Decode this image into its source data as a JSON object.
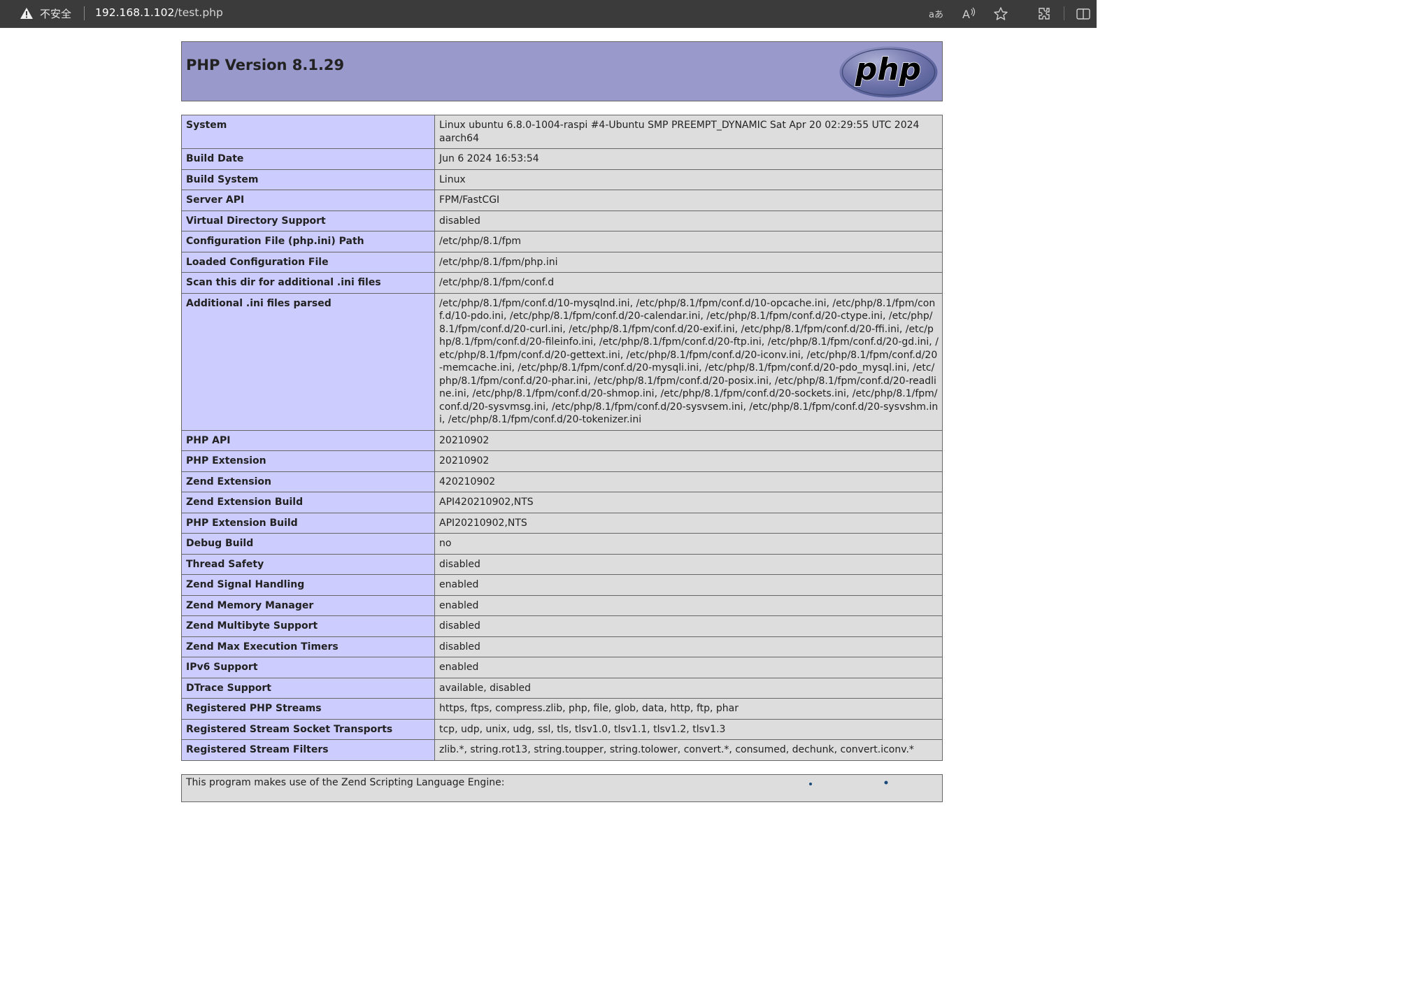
{
  "browser": {
    "security_label": "不安全",
    "url_host": "192.168.1.102",
    "url_path": "/test.php",
    "icons": [
      "warning-icon",
      "read-aloud-icon",
      "text-size-icon",
      "favorite-star-icon",
      "extensions-icon",
      "split-screen-icon"
    ]
  },
  "php": {
    "title": "PHP Version 8.1.29",
    "logo_text": "php"
  },
  "rows": [
    {
      "k": "System",
      "v": "Linux ubuntu 6.8.0-1004-raspi #4-Ubuntu SMP PREEMPT_DYNAMIC Sat Apr 20 02:29:55 UTC 2024 aarch64"
    },
    {
      "k": "Build Date",
      "v": "Jun 6 2024 16:53:54"
    },
    {
      "k": "Build System",
      "v": "Linux"
    },
    {
      "k": "Server API",
      "v": "FPM/FastCGI"
    },
    {
      "k": "Virtual Directory Support",
      "v": "disabled"
    },
    {
      "k": "Configuration File (php.ini) Path",
      "v": "/etc/php/8.1/fpm"
    },
    {
      "k": "Loaded Configuration File",
      "v": "/etc/php/8.1/fpm/php.ini"
    },
    {
      "k": "Scan this dir for additional .ini files",
      "v": "/etc/php/8.1/fpm/conf.d"
    },
    {
      "k": "Additional .ini files parsed",
      "v": "/etc/php/8.1/fpm/conf.d/10-mysqlnd.ini, /etc/php/8.1/fpm/conf.d/10-opcache.ini, /etc/php/8.1/fpm/conf.d/10-pdo.ini, /etc/php/8.1/fpm/conf.d/20-calendar.ini, /etc/php/8.1/fpm/conf.d/20-ctype.ini, /etc/php/8.1/fpm/conf.d/20-curl.ini, /etc/php/8.1/fpm/conf.d/20-exif.ini, /etc/php/8.1/fpm/conf.d/20-ffi.ini, /etc/php/8.1/fpm/conf.d/20-fileinfo.ini, /etc/php/8.1/fpm/conf.d/20-ftp.ini, /etc/php/8.1/fpm/conf.d/20-gd.ini, /etc/php/8.1/fpm/conf.d/20-gettext.ini, /etc/php/8.1/fpm/conf.d/20-iconv.ini, /etc/php/8.1/fpm/conf.d/20-memcache.ini, /etc/php/8.1/fpm/conf.d/20-mysqli.ini, /etc/php/8.1/fpm/conf.d/20-pdo_mysql.ini, /etc/php/8.1/fpm/conf.d/20-phar.ini, /etc/php/8.1/fpm/conf.d/20-posix.ini, /etc/php/8.1/fpm/conf.d/20-readline.ini, /etc/php/8.1/fpm/conf.d/20-shmop.ini, /etc/php/8.1/fpm/conf.d/20-sockets.ini, /etc/php/8.1/fpm/conf.d/20-sysvmsg.ini, /etc/php/8.1/fpm/conf.d/20-sysvsem.ini, /etc/php/8.1/fpm/conf.d/20-sysvshm.ini, /etc/php/8.1/fpm/conf.d/20-tokenizer.ini",
      "long": true
    },
    {
      "k": "PHP API",
      "v": "20210902"
    },
    {
      "k": "PHP Extension",
      "v": "20210902"
    },
    {
      "k": "Zend Extension",
      "v": "420210902"
    },
    {
      "k": "Zend Extension Build",
      "v": "API420210902,NTS"
    },
    {
      "k": "PHP Extension Build",
      "v": "API20210902,NTS"
    },
    {
      "k": "Debug Build",
      "v": "no"
    },
    {
      "k": "Thread Safety",
      "v": "disabled"
    },
    {
      "k": "Zend Signal Handling",
      "v": "enabled"
    },
    {
      "k": "Zend Memory Manager",
      "v": "enabled"
    },
    {
      "k": "Zend Multibyte Support",
      "v": "disabled"
    },
    {
      "k": "Zend Max Execution Timers",
      "v": "disabled"
    },
    {
      "k": "IPv6 Support",
      "v": "enabled"
    },
    {
      "k": "DTrace Support",
      "v": "available, disabled"
    },
    {
      "k": "Registered PHP Streams",
      "v": "https, ftps, compress.zlib, php, file, glob, data, http, ftp, phar"
    },
    {
      "k": "Registered Stream Socket Transports",
      "v": "tcp, udp, unix, udg, ssl, tls, tlsv1.0, tlsv1.1, tlsv1.2, tlsv1.3"
    },
    {
      "k": "Registered Stream Filters",
      "v": "zlib.*, string.rot13, string.toupper, string.tolower, convert.*, consumed, dechunk, convert.iconv.*"
    }
  ],
  "footer": {
    "text": "This program makes use of the Zend Scripting Language Engine:"
  },
  "colors": {
    "header_bg": "#9999cc",
    "key_bg": "#ccccff",
    "value_bg": "#dddddd",
    "border": "#666666",
    "bar_bg": "#3b3b3b"
  }
}
